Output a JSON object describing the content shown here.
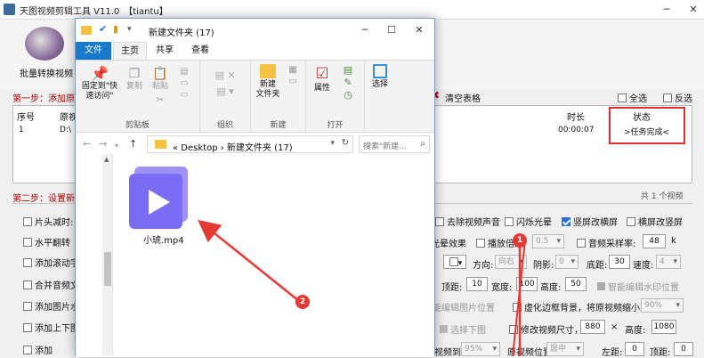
{
  "app": {
    "title": "天图视频剪辑工具 V11.0　【tiantu】",
    "batch_label": "批量转换视频",
    "step1": "第一步：添加原",
    "clear_table": "清空表格",
    "select_all": "全选",
    "invert_select": "反选",
    "grid": {
      "col_index": "序号",
      "col_source": "原视",
      "col_duration": "时长",
      "col_status": "状态",
      "row_index": "1",
      "row_source": "D:\\",
      "row_duration": "00:00:07",
      "row_status": ">任务完成<"
    },
    "step2": "第二步：设置新",
    "count": "共 1 个视频",
    "options": {
      "cut_head": "片头减时:",
      "hflip": "水平翻转",
      "add_scroll": "添加滚动字",
      "merge_audio": "合并音频文",
      "add_image": "添加图片水",
      "add_top_bottom": "添加上下图",
      "add_xx": "添加",
      "remove_audio": "去除视频声音",
      "flash": "闪烁光晕",
      "v2h": "竖屏改横屏",
      "h2v": "横屏改竖屏",
      "light_effect": "光晕效果",
      "zoom_rate": "播放倍速",
      "zoom_val": "0.5",
      "sample_rate": "音频采样率:",
      "sample_val": "48",
      "sample_unit": "k",
      "direction": "方向:",
      "direction_val": "向右",
      "shadow": "阴影:",
      "shadow_val": "0",
      "bottom_margin": "底距:",
      "bottom_val": "30",
      "speed": "速度:",
      "speed_val": "4",
      "top_margin": "顶距:",
      "top_val": "10",
      "width": "宽度:",
      "width_val": "100",
      "height": "高度:",
      "height_val": "50",
      "smart_wm": "智能编辑水印位置",
      "smart_img": "能编辑图片位置",
      "blur_bg": "虚化边框背景，将原视频缩小到:",
      "blur_val": "90%",
      "select_bottom": "选择下图",
      "resize": "修改视频尺寸，宽度:",
      "resize_w": "880",
      "resize_x": "×",
      "resize_h_label": "高度:",
      "resize_h": "1080",
      "video_to": "视频到:",
      "video_to_val": "95%",
      "orig_pos": "原视频位置:",
      "orig_pos_val": "居中",
      "left_margin": "左距:",
      "left_val": "0",
      "top2": "顶距:",
      "top2_val": "0"
    }
  },
  "explorer": {
    "title": "新建文件夹 (17)",
    "tabs": [
      "文件",
      "主页",
      "共享",
      "查看"
    ],
    "ribbon": {
      "pin_label": "固定到\"快\n速访问\"",
      "copy": "复制",
      "paste": "粘贴",
      "group_clipboard": "剪贴板",
      "group_organize": "组织",
      "new_folder": "新建\n文件夹",
      "group_new": "新建",
      "properties": "属性",
      "group_open": "打开",
      "select": "选择"
    },
    "address": "«  Desktop  ›  新建文件夹 (17)",
    "search_placeholder": "搜索\"新建...",
    "file_name": "小琥.mp4"
  },
  "badges": [
    "1",
    "2"
  ],
  "colors": {
    "accent": "#1979ca",
    "arrow": "#e53935",
    "folder": "#f6c244",
    "video_icon": "#7b6cf6"
  }
}
